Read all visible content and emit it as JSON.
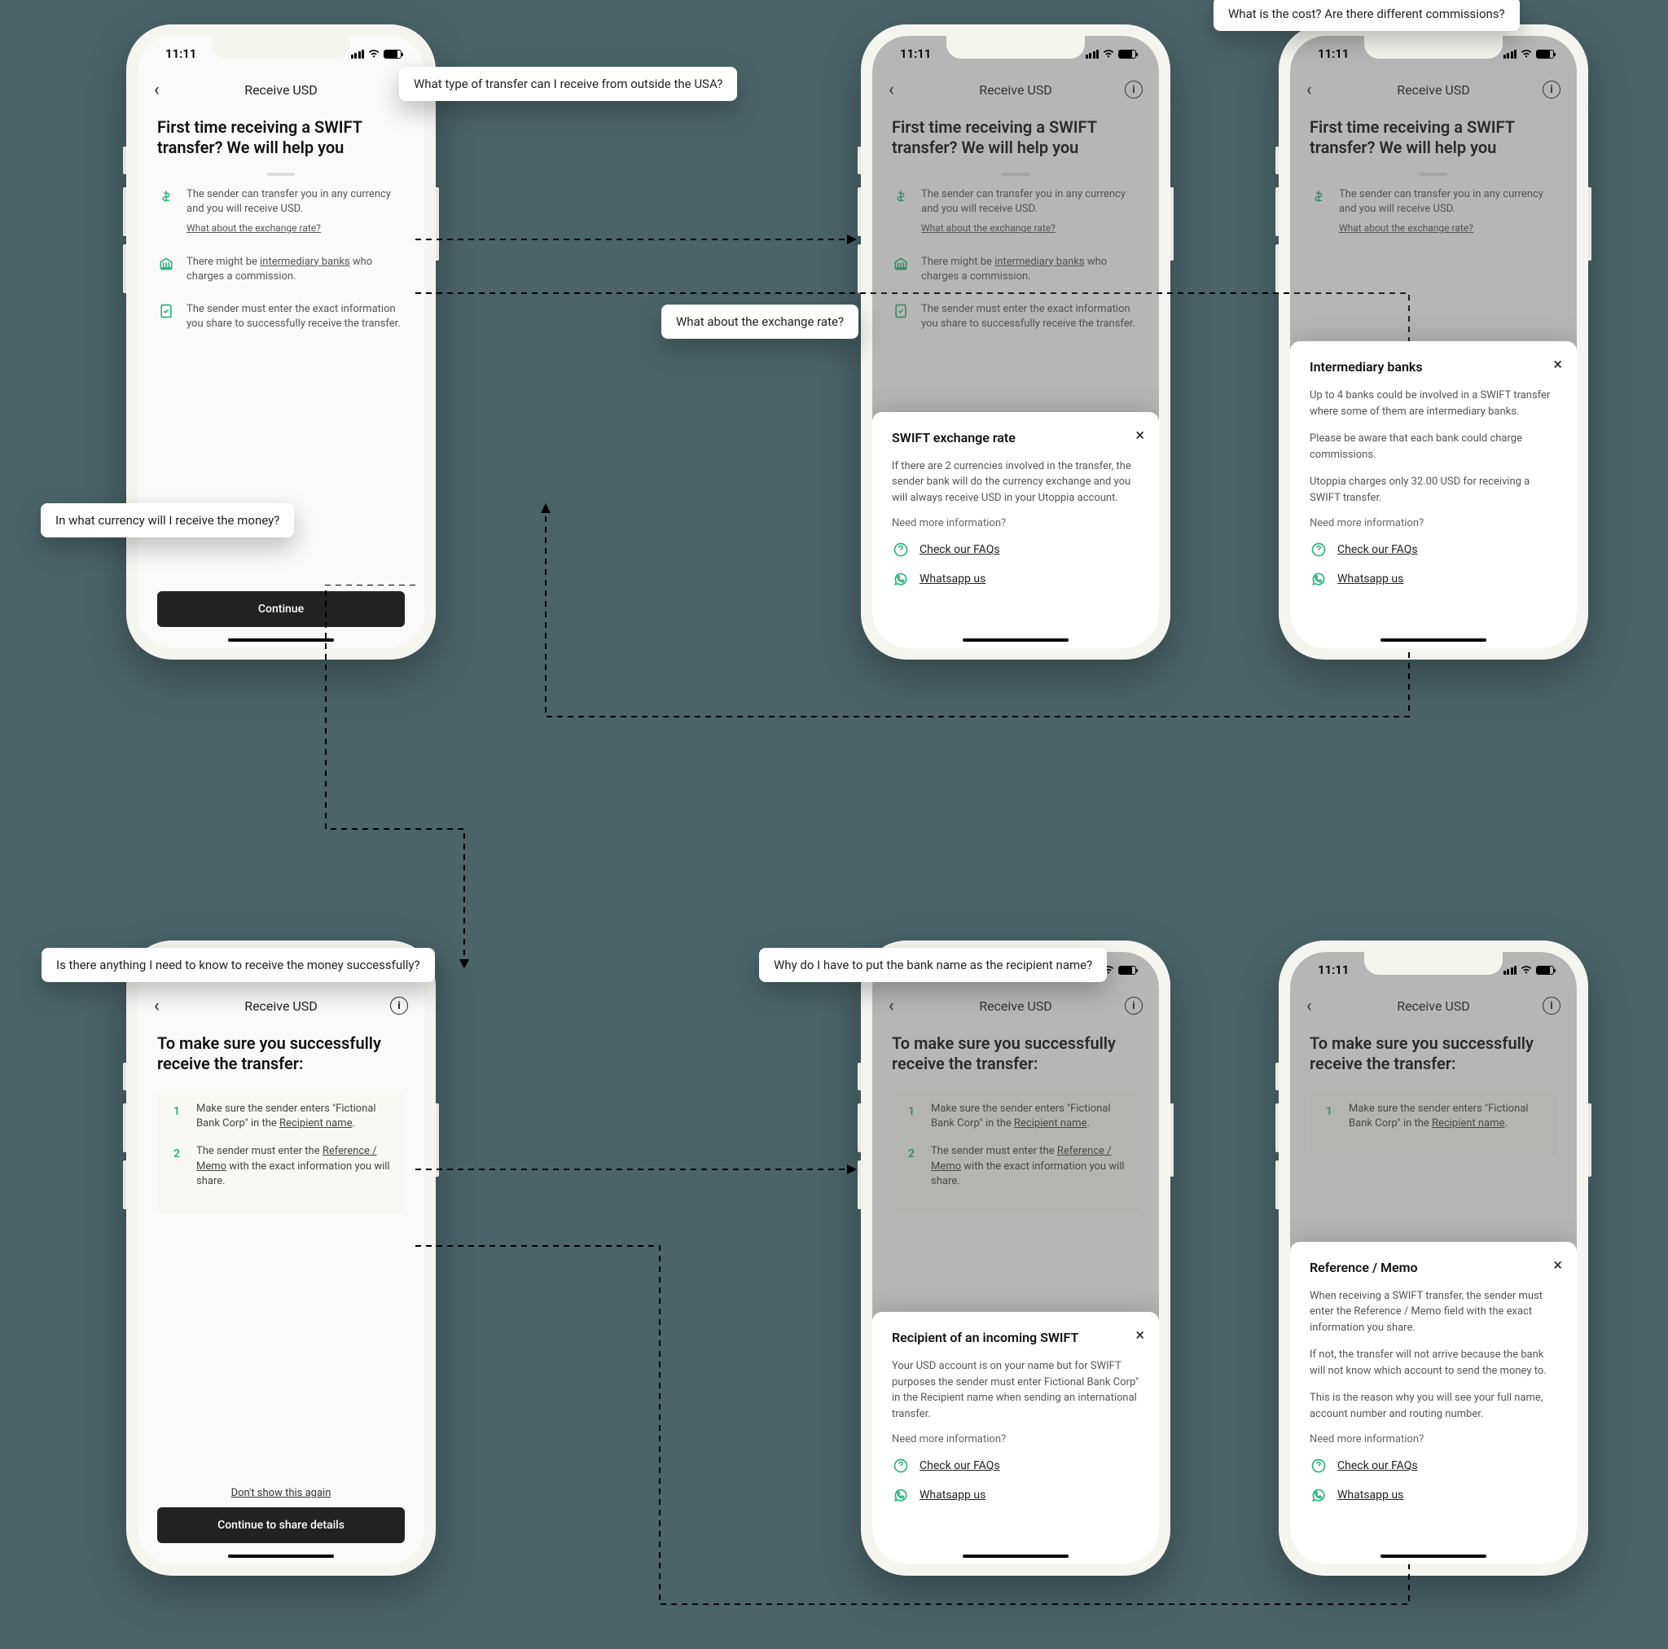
{
  "status": {
    "time": "11:11"
  },
  "nav": {
    "title": "Receive USD"
  },
  "main": {
    "heading": "First time receiving a SWIFT transfer? We will help you",
    "i1": {
      "text": "The sender can transfer you in any currency and you will receive USD.",
      "link": "What about the exchange rate?"
    },
    "i2": {
      "pre": "There might be ",
      "link": "intermediary banks",
      "post": " who charges a commission."
    },
    "i3": {
      "text": "The sender must enter the exact information you share to successfully receive the transfer."
    },
    "cta": "Continue"
  },
  "sheet_rate": {
    "title": "SWIFT exchange rate",
    "body": "If there are 2 currencies involved in the transfer, the sender bank will do the currency exchange and you will always receive USD in your Utoppia account."
  },
  "sheet_banks": {
    "title": "Intermediary banks",
    "p1": "Up to 4 banks could be involved in a SWIFT transfer where some of them are intermediary banks.",
    "p2": "Please be aware that each bank could charge commissions.",
    "p3": "Utoppia charges only 32.00 USD for receiving a SWIFT transfer."
  },
  "more_info": "Need more information?",
  "faq": "Check our FAQs",
  "whatsapp": "Whatsapp us",
  "tips": {
    "heading": "To make sure you successfully receive the transfer:",
    "t1_pre": "Make sure the sender enters \"Fictional Bank Corp\" in the ",
    "t1_link": "Recipient name",
    "t2_pre": "The sender must enter the ",
    "t2_link": "Reference / Memo",
    "t2_post": " with the exact information you will share.",
    "skip": "Don't show this again",
    "cta": "Continue to share details"
  },
  "sheet_recipient": {
    "title": "Recipient of an incoming SWIFT",
    "body": "Your USD account is on your name but for SWIFT purposes the sender must enter Fictional Bank Corp\" in the Recipient name when sending an international transfer."
  },
  "sheet_memo": {
    "title": "Reference / Memo",
    "p1": "When receiving a SWIFT transfer, the sender must enter the Reference / Memo field with the exact information you share.",
    "p2": "If not, the transfer will not arrive because the bank will not know which account to send the money to.",
    "p3": "This is the reason why you will see your full name, account number and routing number."
  },
  "callouts": {
    "c1": "What type of transfer can I receive from outside the USA?",
    "c2": "In what currency will I receive the money?",
    "c3": "What about the exchange rate?",
    "c4": "What is the cost? Are there different commissions?",
    "c5": "Is there anything I need to know to receive the money successfully?",
    "c6": "Why do I have to put the bank name as the recipient name?"
  }
}
